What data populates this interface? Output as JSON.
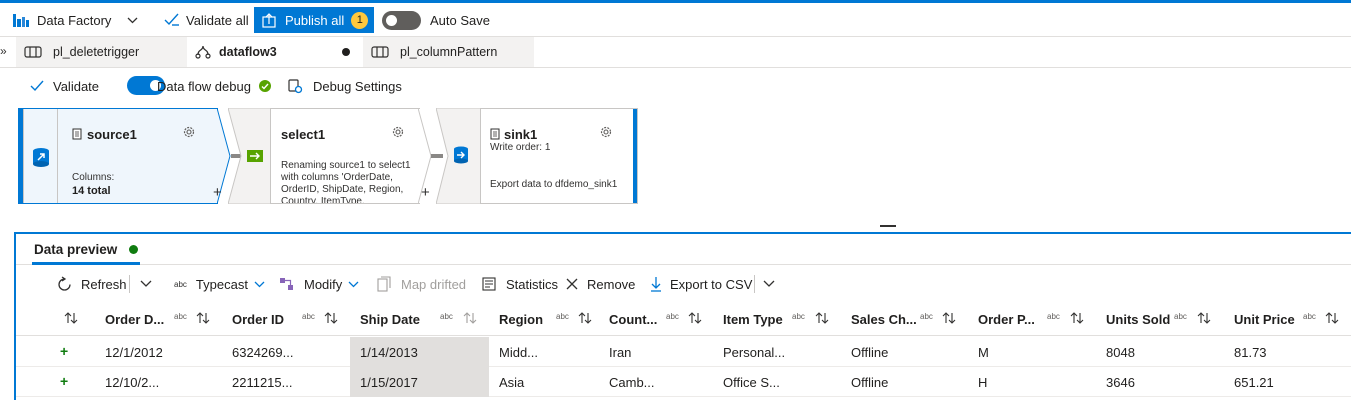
{
  "topbar": {
    "factory_label": "Data Factory",
    "validate_all": "Validate all",
    "publish_all": "Publish all",
    "publish_count": "1",
    "auto_save": "Auto Save"
  },
  "tabs": [
    {
      "label": "pl_deletetrigger"
    },
    {
      "label": "dataflow3"
    },
    {
      "label": "pl_columnPattern"
    }
  ],
  "subbar": {
    "validate": "Validate",
    "debug_label": "Data flow debug",
    "debug_settings": "Debug Settings"
  },
  "nodes": {
    "source": {
      "title": "source1",
      "line1": "Columns:",
      "line2": "14 total"
    },
    "select": {
      "title": "select1",
      "lines": [
        "Renaming source1 to select1",
        "with columns 'OrderDate,",
        "OrderID, ShipDate, Region,",
        "Country, ItemType,"
      ]
    },
    "sink": {
      "title": "sink1",
      "order": "Write order: 1",
      "desc": "Export data to dfdemo_sink1"
    }
  },
  "preview": {
    "tab_label": "Data preview",
    "toolbar": {
      "refresh": "Refresh",
      "typecast": "Typecast",
      "modify": "Modify",
      "map_drifted": "Map drifted",
      "statistics": "Statistics",
      "remove": "Remove",
      "export_csv": "Export to CSV"
    },
    "type_tag": "abc",
    "columns": [
      "Order D...",
      "Order ID",
      "Ship Date",
      "Region",
      "Count...",
      "Item Type",
      "Sales Ch...",
      "Order P...",
      "Units Sold",
      "Unit Price"
    ],
    "rows": [
      [
        "12/1/2012",
        "6324269...",
        "1/14/2013",
        "Midd...",
        "Iran",
        "Personal...",
        "Offline",
        "M",
        "8048",
        "81.73"
      ],
      [
        "12/10/2...",
        "2211215...",
        "1/15/2017",
        "Asia",
        "Camb...",
        "Office S...",
        "Offline",
        "H",
        "3646",
        "651.21"
      ]
    ]
  },
  "colors": {
    "accent": "#0078d4",
    "badge": "#ffc83d",
    "success": "#57a300"
  }
}
